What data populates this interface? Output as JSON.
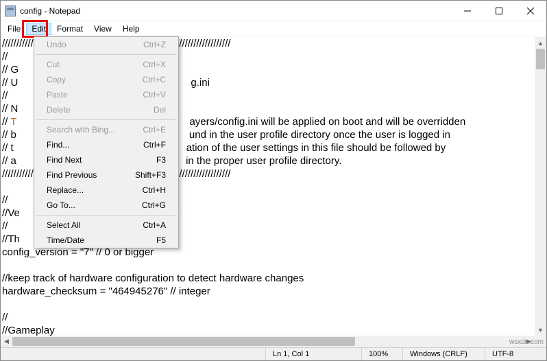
{
  "window": {
    "title": "config - Notepad"
  },
  "menubar": {
    "file": "File",
    "edit": "Edit",
    "format": "Format",
    "view": "View",
    "help": "Help"
  },
  "dropdown": {
    "undo": {
      "label": "Undo",
      "shortcut": "Ctrl+Z"
    },
    "cut": {
      "label": "Cut",
      "shortcut": "Ctrl+X"
    },
    "copy": {
      "label": "Copy",
      "shortcut": "Ctrl+C"
    },
    "paste": {
      "label": "Paste",
      "shortcut": "Ctrl+V"
    },
    "delete": {
      "label": "Delete",
      "shortcut": "Del"
    },
    "search_bing": {
      "label": "Search with Bing...",
      "shortcut": "Ctrl+E"
    },
    "find": {
      "label": "Find...",
      "shortcut": "Ctrl+F"
    },
    "find_next": {
      "label": "Find Next",
      "shortcut": "F3"
    },
    "find_prev": {
      "label": "Find Previous",
      "shortcut": "Shift+F3"
    },
    "replace": {
      "label": "Replace...",
      "shortcut": "Ctrl+H"
    },
    "goto": {
      "label": "Go To...",
      "shortcut": "Ctrl+G"
    },
    "select_all": {
      "label": "Select All",
      "shortcut": "Ctrl+A"
    },
    "time_date": {
      "label": "Time/Date",
      "shortcut": "F5"
    }
  },
  "editor": {
    "l1": "////////////////////////////////////////////////////////////////////////////////",
    "l2": "//",
    "l3": "// G",
    "l4": "// U",
    "l4b": "g.ini",
    "l5": "//",
    "l6": "// N",
    "l7a": "// ",
    "l7b": "T",
    "l7c": "ayers/config.ini will be applied on boot and will be overridden",
    "l8": "// b",
    "l8b": "und in the user profile directory once the user is logged in",
    "l9": "// t",
    "l9b": "ation of the user settings in this file should be followed by",
    "l10": "// a",
    "l10b": " in the proper user profile directory.",
    "l11": "////////////////////////////////////////////////////////////////////////////////",
    "l12": "",
    "l13": "//",
    "l14": "//Ve",
    "l15": "//",
    "l16": "//Th",
    "l17": "config_version = \"7\" // 0 or bigger",
    "l18": "",
    "l19": "//keep track of hardware configuration to detect hardware changes",
    "l20": "hardware_checksum = \"464945276\" // integer",
    "l21": "",
    "l22": "//",
    "l23": "//Gameplay"
  },
  "status": {
    "pos": "Ln 1, Col 1",
    "zoom": "100%",
    "eol": "Windows (CRLF)",
    "enc": "UTF-8"
  },
  "watermark": "wsxdn.com"
}
